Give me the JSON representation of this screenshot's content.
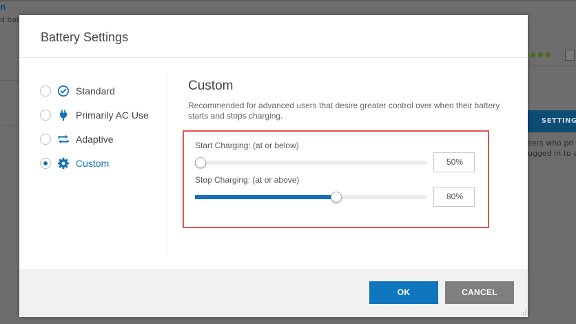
{
  "background": {
    "left_title": "n",
    "left_sub": "d bat",
    "settings_button": "SETTINGS",
    "right_text_1": "sers who pri",
    "right_text_2": "ugged in to a"
  },
  "dialog": {
    "title": "Battery Settings",
    "modes": [
      {
        "label": "Standard",
        "icon": "check-circle-icon",
        "selected": false
      },
      {
        "label": "Primarily AC Use",
        "icon": "plug-icon",
        "selected": false
      },
      {
        "label": "Adaptive",
        "icon": "swap-arrows-icon",
        "selected": false
      },
      {
        "label": "Custom",
        "icon": "gear-icon",
        "selected": true
      }
    ],
    "custom": {
      "title": "Custom",
      "description": "Recommended for advanced users that desire greater control over when their battery starts and stops charging.",
      "start": {
        "label": "Start Charging: (at or below)",
        "value": "50%",
        "level": 0.0
      },
      "stop": {
        "label": "Stop Charging: (at or above)",
        "value": "80%",
        "level": 0.6
      }
    },
    "ok_label": "OK",
    "cancel_label": "CANCEL"
  },
  "colors": {
    "accent": "#1572b6",
    "highlight": "#e2534b",
    "cancel": "#7f7f7f"
  }
}
